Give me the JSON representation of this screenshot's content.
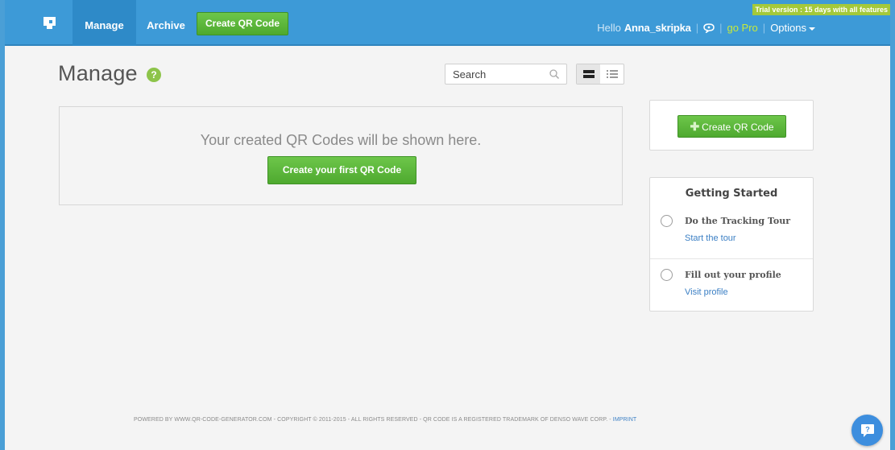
{
  "nav": {
    "manage": "Manage",
    "archive": "Archive",
    "create_button": "Create QR Code",
    "trial": "Trial version : 15 days with all features",
    "hello": "Hello",
    "username": "Anna_skripka",
    "go_pro": "go Pro",
    "options": "Options"
  },
  "page": {
    "title": "Manage",
    "help": "?",
    "search_placeholder": "Search"
  },
  "empty": {
    "message": "Your created QR Codes will be shown here.",
    "button": "Create your first QR Code"
  },
  "sidebar": {
    "create_button": "Create QR Code",
    "getting_started": {
      "title": "Getting Started",
      "items": [
        {
          "label": "Do the Tracking Tour",
          "link": "Start the tour"
        },
        {
          "label": "Fill out your profile",
          "link": "Visit profile"
        }
      ]
    }
  },
  "footer": {
    "text": "POWERED BY WWW.QR-CODE-GENERATOR.COM - COPYRIGHT © 2011-2015 - ALL RIGHTS RESERVED - QR CODE IS A REGISTERED TRADEMARK OF DENSO WAVE CORP. - ",
    "imprint": "IMPRINT"
  },
  "colors": {
    "topbar": "#3d9ad7",
    "accent_green": "#5cb83a",
    "trial_badge": "#a4c93a",
    "link_blue": "#3b7fc4"
  },
  "icons": [
    "logo-icon",
    "help-icon",
    "search-icon",
    "grid-view-icon",
    "list-view-icon",
    "plus-icon",
    "chat-icon",
    "speech-bubble-icon"
  ]
}
